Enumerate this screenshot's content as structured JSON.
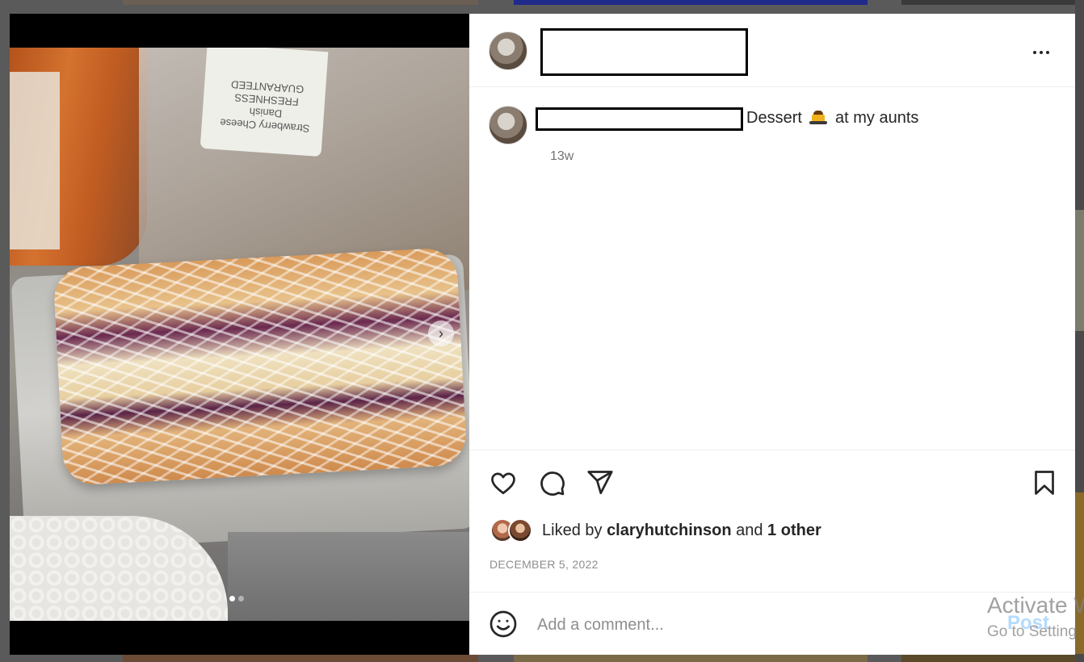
{
  "post": {
    "caption_text": "Dessert",
    "caption_suffix": "at my aunts",
    "emoji": "custard-pudding",
    "time_ago": "13w",
    "date": "DECEMBER 5, 2022"
  },
  "photo": {
    "label_text": "Strawberry Cheese Danish\nFRESHNESS GUARANTEED",
    "carousel_index": 1,
    "carousel_total": 2
  },
  "likes": {
    "prefix": "Liked by",
    "user": "claryhutchinson",
    "conjunction": "and",
    "others": "1 other"
  },
  "comment_box": {
    "placeholder": "Add a comment...",
    "post_label": "Post"
  },
  "watermark": {
    "line1": "Activate W",
    "line2": "Go to Setting"
  },
  "colors": {
    "post_button": "#b3dbff",
    "text_primary": "#262626",
    "text_secondary": "#737373"
  }
}
